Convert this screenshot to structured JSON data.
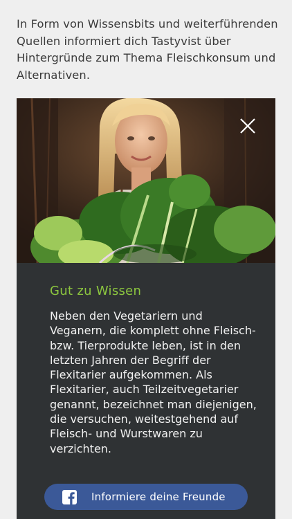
{
  "intro": {
    "text": "In Form von Wissensbits und weiterführenden Quellen informiert dich Tastyvist über Hintergründe zum Thema Fleischkonsum und Alternativen."
  },
  "card": {
    "image_alt": "Frau mit Blattgemüse",
    "close_icon": "close-icon",
    "heading": "Gut zu Wissen",
    "body": "Neben den Vegetariern und Veganern, die komplett ohne Fleisch- bzw. Tierprodukte leben, ist in den letzten Jahren der Begriff der Flexitarier aufgekommen. Als Flexitarier, auch Teilzeitvegetarier genannt, bezeichnet man diejenigen, die versuchen, weitestgehend auf Fleisch- und Wurstwaren zu verzichten.",
    "share_button": {
      "label": "Informiere deine Freunde",
      "icon": "facebook-icon"
    }
  },
  "colors": {
    "page_bg": "#efefef",
    "card_bg": "#2f3234",
    "accent_green": "#8cc63f",
    "facebook_blue": "#3b5998"
  }
}
